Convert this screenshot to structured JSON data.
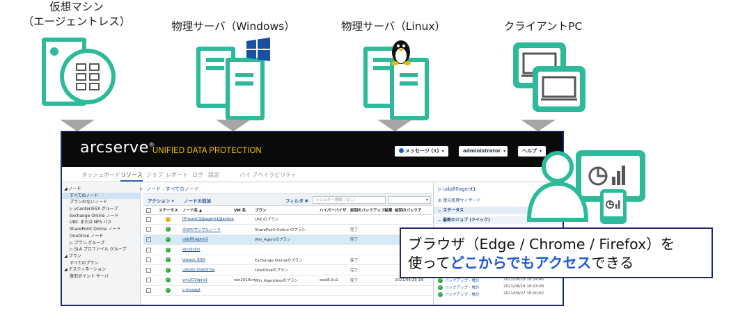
{
  "devices": [
    {
      "label": "仮想マシン\n（エージェントレス）",
      "icon": "virtual-machine-icon"
    },
    {
      "label": "物理サーバ（Windows）",
      "icon": "windows-server-icon"
    },
    {
      "label": "物理サーバ（Linux）",
      "icon": "linux-server-icon"
    },
    {
      "label": "クライアントPC",
      "icon": "client-pc-icon"
    }
  ],
  "colors": {
    "accent": "#2cba9b",
    "arrow": "#a6a6a6",
    "border": "#1c2a6b",
    "highlight": "#1e5bd6"
  },
  "console": {
    "logo": "arcserve",
    "tm": "®",
    "product": "UNIFIED DATA PROTECTION",
    "header_buttons": {
      "messages": "メッセージ (1)",
      "user": "administrator",
      "help": "ヘルプ"
    },
    "tabs": [
      "ダッシュボード",
      "リソース",
      "ジョブ",
      "レポート",
      "ログ",
      "設定",
      "ハイ アベイラビリティ"
    ],
    "tree": [
      "◢ ノード",
      "すべてのノード",
      "プランのないノード",
      "▷ vCenter/ESX グループ",
      "Exchange Online ノード",
      "UNC または NFS パス",
      "SharePoint Online ノード",
      "OneDrive ノード",
      "▷ プラン グループ",
      "▷ SLA プロファイル グループ",
      "◢ プラン",
      "すべてのプラン",
      "◢ デスティネーション",
      "復旧ポイント サーバ"
    ],
    "breadcrumb": "ノード : すべてのノード",
    "toolbar": {
      "action": "アクション ▾",
      "add_node": "ノードの追加",
      "filter": "フィルタ ¥",
      "filter_placeholder": "ショルター理解（なし）"
    },
    "columns": [
      "",
      "ステータス",
      "ノード名 ▲",
      "VM 名",
      "プラン",
      "ハイパーバイザ",
      "前回のバックアップ結果",
      "前回のバックア"
    ],
    "rows": [
      {
        "status": "warn",
        "name": "[Private]1@agent1@ashee",
        "vm": "",
        "plan": "UNCのプラン",
        "hyper": "",
        "result": "",
        "last": "",
        "sel": false
      },
      {
        "status": "ok",
        "name": "のSPOサンプルノード",
        "vm": "",
        "plan": "SharePoint Online のプラン",
        "hyper": "",
        "result": "完了",
        "last": "",
        "sel": false
      },
      {
        "status": "ok",
        "name": "udp80agent1",
        "vm": "",
        "plan": "Win_Agentのプラン",
        "hyper": "",
        "result": "完了",
        "last": "",
        "sel": true
      },
      {
        "status": "ok",
        "name": "arcsilsilin",
        "vm": "",
        "plan": "",
        "hyper": "",
        "result": "",
        "last": "",
        "sel": false
      },
      {
        "status": "ok",
        "name": "Ustock_EXO",
        "vm": "",
        "plan": "Exchange Onlineのプラン",
        "hyper": "",
        "result": "完了",
        "last": "",
        "sel": false
      },
      {
        "status": "ok",
        "name": "udosto OneDrive",
        "vm": "",
        "plan": "OneDriveのプラン",
        "hyper": "",
        "result": "完了",
        "last": "",
        "sel": false
      },
      {
        "status": "ok",
        "name": "win2019pro1",
        "vm": "win2019vm1",
        "plan": "Win_Agentlessのプラン",
        "hyper": "esxi8.0u1",
        "result": "完了",
        "last": "2021/04/29 18:",
        "sel": false
      },
      {
        "status": "ok",
        "name": "c-inuxagt",
        "vm": "",
        "plan": "",
        "hyper": "",
        "result": "",
        "last": "",
        "sel": false
      }
    ],
    "right_panel": {
      "title": "▷ udp80agent1",
      "wizard": "復元処理ウィザード",
      "status_header": "ステータス",
      "jobs_header": "最新のジョブ (クイック)",
      "jobs": [
        {
          "label": "バックアップ - 増分",
          "time": "2021/06/18 18:14:46"
        },
        {
          "label": "バックアップ - 増分",
          "time": "2021/06/18 18:03:08"
        },
        {
          "label": "バックアップ - 増分",
          "time": "2021/04/27 18:00:02"
        }
      ]
    }
  },
  "callout": {
    "line1": "ブラウザ（Edge / Chrome / Firefox）を",
    "line2_prefix": "使って",
    "line2_em": "どこからでもアクセス",
    "line2_suffix": "できる"
  }
}
